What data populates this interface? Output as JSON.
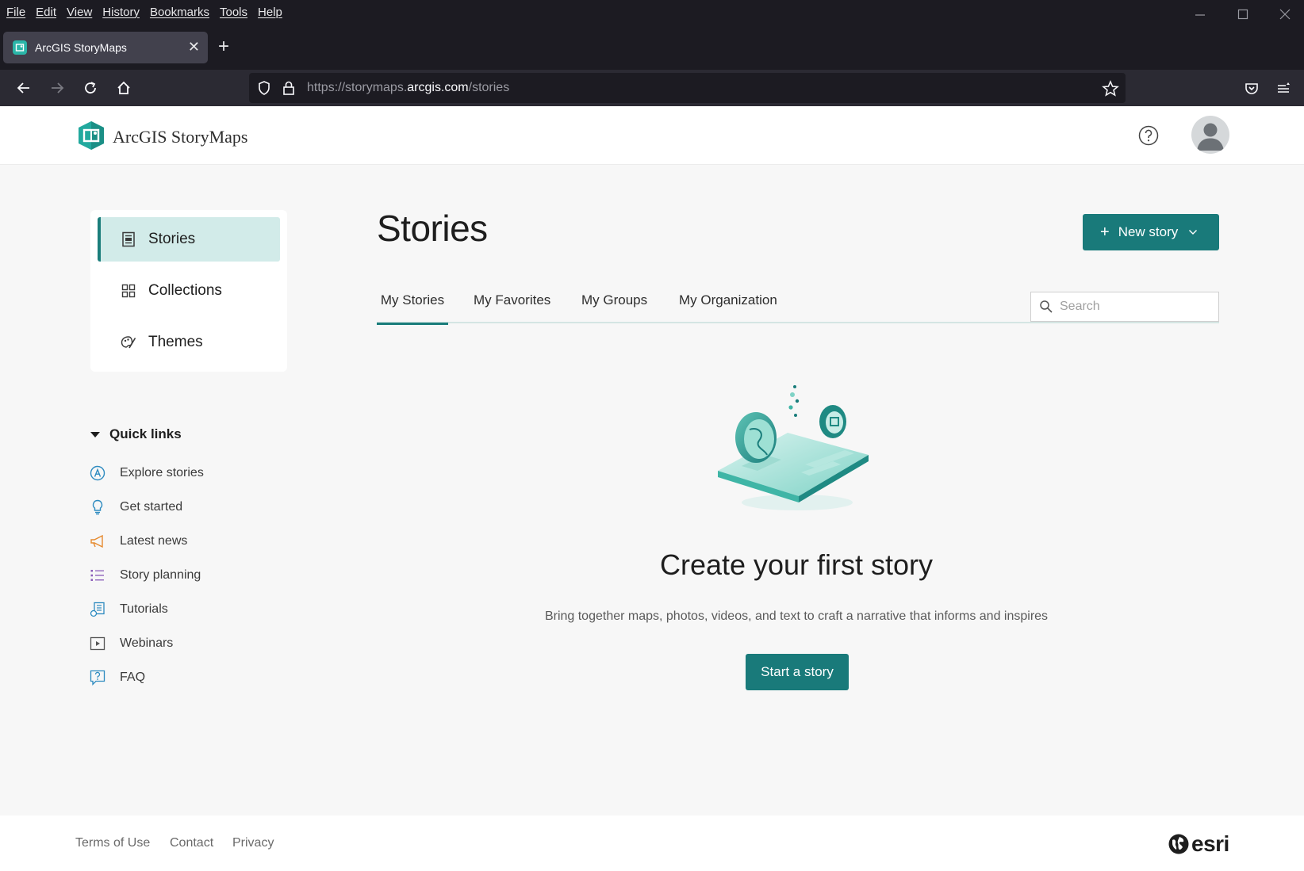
{
  "browser": {
    "menu": [
      "File",
      "Edit",
      "View",
      "History",
      "Bookmarks",
      "Tools",
      "Help"
    ],
    "tab_title": "ArcGIS StoryMaps",
    "tab_close": "✕",
    "new_tab": "+",
    "url_prefix": "https://storymaps.",
    "url_host": "arcgis.com",
    "url_path": "/stories"
  },
  "app": {
    "name": "ArcGIS StoryMaps"
  },
  "sidebar": {
    "items": [
      {
        "label": "Stories",
        "icon": "story-document-icon",
        "active": true
      },
      {
        "label": "Collections",
        "icon": "grid-icon",
        "active": false
      },
      {
        "label": "Themes",
        "icon": "palette-icon",
        "active": false
      }
    ]
  },
  "quick_links": {
    "title": "Quick links",
    "items": [
      {
        "label": "Explore stories",
        "icon": "explore-icon",
        "color": "#2e8bc0"
      },
      {
        "label": "Get started",
        "icon": "lightbulb-icon",
        "color": "#2e8bc0"
      },
      {
        "label": "Latest news",
        "icon": "megaphone-icon",
        "color": "#e68a2e"
      },
      {
        "label": "Story planning",
        "icon": "list-icon",
        "color": "#8a5cb8"
      },
      {
        "label": "Tutorials",
        "icon": "tutorial-icon",
        "color": "#2e8bc0"
      },
      {
        "label": "Webinars",
        "icon": "play-icon",
        "color": "#555555"
      },
      {
        "label": "FAQ",
        "icon": "faq-icon",
        "color": "#2e8bc0"
      }
    ]
  },
  "main": {
    "title": "Stories",
    "new_story_label": "New story",
    "tabs": [
      "My Stories",
      "My Favorites",
      "My Groups",
      "My Organization"
    ],
    "search_placeholder": "Search",
    "empty_title": "Create your first story",
    "empty_subtitle": "Bring together maps, photos, videos, and text to craft a narrative that informs and inspires",
    "start_label": "Start a story"
  },
  "footer": {
    "links": [
      "Terms of Use",
      "Contact",
      "Privacy"
    ],
    "brand": "esri"
  },
  "colors": {
    "accent": "#197a7a",
    "active_bg": "#d2ebe9",
    "chrome_bg": "#1c1b22"
  }
}
